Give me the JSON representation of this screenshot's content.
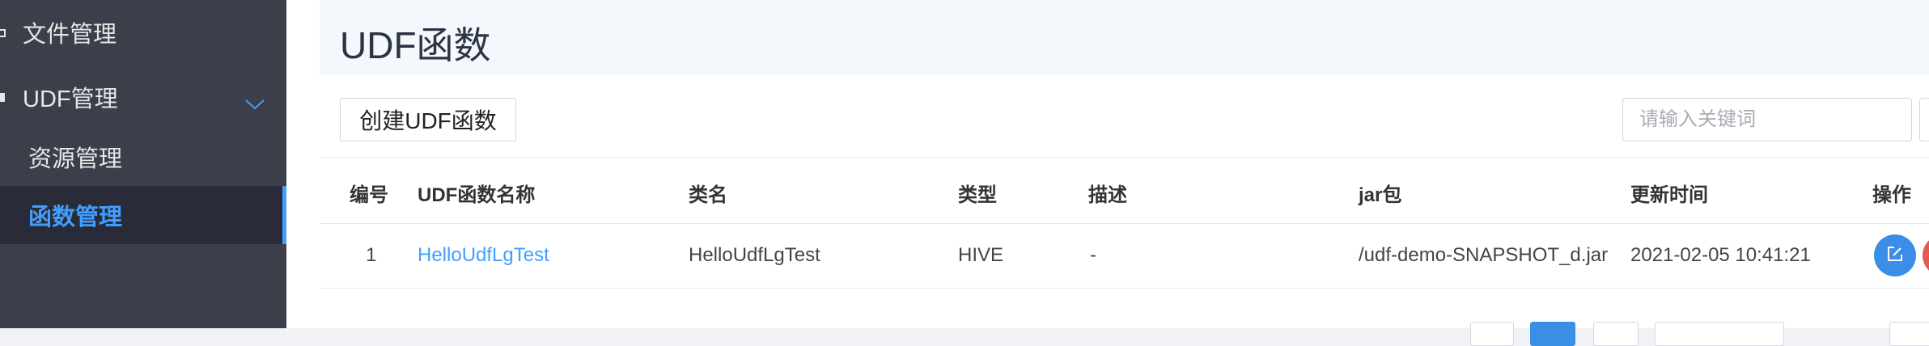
{
  "sidebar": {
    "items": [
      {
        "label": "文件管理",
        "icon": "folder-icon"
      },
      {
        "label": "UDF管理",
        "icon": "udf-icon",
        "expanded": true
      },
      {
        "label": "资源管理"
      },
      {
        "label": "函数管理",
        "active": true
      }
    ]
  },
  "page": {
    "title": "UDF函数"
  },
  "toolbar": {
    "create_label": "创建UDF函数",
    "search_placeholder": "请输入关键词"
  },
  "table": {
    "columns": [
      "编号",
      "UDF函数名称",
      "类名",
      "类型",
      "描述",
      "jar包",
      "更新时间",
      "操作"
    ],
    "rows": [
      {
        "id": "1",
        "name": "HelloUdfLgTest",
        "class_name": "HelloUdfLgTest",
        "type": "HIVE",
        "description": "-",
        "jar": "/udf-demo-SNAPSHOT_d.jar",
        "updated": "2021-02-05 10:41:21"
      }
    ]
  },
  "colors": {
    "sidebar_bg": "#3c3f4a",
    "sidebar_active_bg": "#292c38",
    "accent": "#409eff",
    "edit_button": "#3a8ee6",
    "delete_button": "#e65a4f"
  }
}
